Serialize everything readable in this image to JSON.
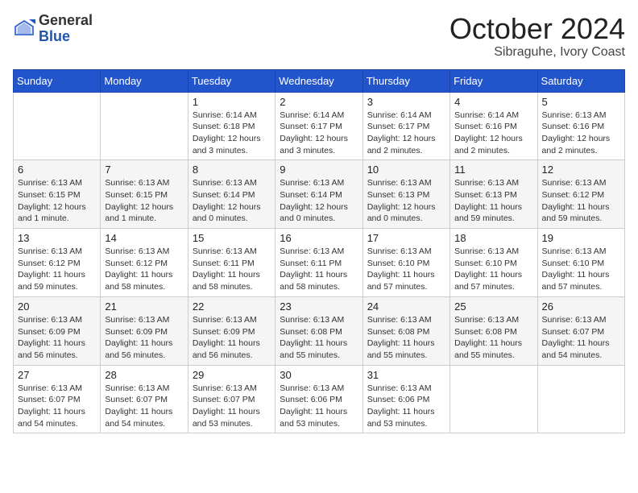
{
  "header": {
    "logo": {
      "general": "General",
      "blue": "Blue"
    },
    "month": "October 2024",
    "location": "Sibraguhe, Ivory Coast"
  },
  "weekdays": [
    "Sunday",
    "Monday",
    "Tuesday",
    "Wednesday",
    "Thursday",
    "Friday",
    "Saturday"
  ],
  "weeks": [
    [
      {
        "day": "",
        "sunrise": "",
        "sunset": "",
        "daylight": ""
      },
      {
        "day": "",
        "sunrise": "",
        "sunset": "",
        "daylight": ""
      },
      {
        "day": "1",
        "sunrise": "Sunrise: 6:14 AM",
        "sunset": "Sunset: 6:18 PM",
        "daylight": "Daylight: 12 hours and 3 minutes."
      },
      {
        "day": "2",
        "sunrise": "Sunrise: 6:14 AM",
        "sunset": "Sunset: 6:17 PM",
        "daylight": "Daylight: 12 hours and 3 minutes."
      },
      {
        "day": "3",
        "sunrise": "Sunrise: 6:14 AM",
        "sunset": "Sunset: 6:17 PM",
        "daylight": "Daylight: 12 hours and 2 minutes."
      },
      {
        "day": "4",
        "sunrise": "Sunrise: 6:14 AM",
        "sunset": "Sunset: 6:16 PM",
        "daylight": "Daylight: 12 hours and 2 minutes."
      },
      {
        "day": "5",
        "sunrise": "Sunrise: 6:13 AM",
        "sunset": "Sunset: 6:16 PM",
        "daylight": "Daylight: 12 hours and 2 minutes."
      }
    ],
    [
      {
        "day": "6",
        "sunrise": "Sunrise: 6:13 AM",
        "sunset": "Sunset: 6:15 PM",
        "daylight": "Daylight: 12 hours and 1 minute."
      },
      {
        "day": "7",
        "sunrise": "Sunrise: 6:13 AM",
        "sunset": "Sunset: 6:15 PM",
        "daylight": "Daylight: 12 hours and 1 minute."
      },
      {
        "day": "8",
        "sunrise": "Sunrise: 6:13 AM",
        "sunset": "Sunset: 6:14 PM",
        "daylight": "Daylight: 12 hours and 0 minutes."
      },
      {
        "day": "9",
        "sunrise": "Sunrise: 6:13 AM",
        "sunset": "Sunset: 6:14 PM",
        "daylight": "Daylight: 12 hours and 0 minutes."
      },
      {
        "day": "10",
        "sunrise": "Sunrise: 6:13 AM",
        "sunset": "Sunset: 6:13 PM",
        "daylight": "Daylight: 12 hours and 0 minutes."
      },
      {
        "day": "11",
        "sunrise": "Sunrise: 6:13 AM",
        "sunset": "Sunset: 6:13 PM",
        "daylight": "Daylight: 11 hours and 59 minutes."
      },
      {
        "day": "12",
        "sunrise": "Sunrise: 6:13 AM",
        "sunset": "Sunset: 6:12 PM",
        "daylight": "Daylight: 11 hours and 59 minutes."
      }
    ],
    [
      {
        "day": "13",
        "sunrise": "Sunrise: 6:13 AM",
        "sunset": "Sunset: 6:12 PM",
        "daylight": "Daylight: 11 hours and 59 minutes."
      },
      {
        "day": "14",
        "sunrise": "Sunrise: 6:13 AM",
        "sunset": "Sunset: 6:12 PM",
        "daylight": "Daylight: 11 hours and 58 minutes."
      },
      {
        "day": "15",
        "sunrise": "Sunrise: 6:13 AM",
        "sunset": "Sunset: 6:11 PM",
        "daylight": "Daylight: 11 hours and 58 minutes."
      },
      {
        "day": "16",
        "sunrise": "Sunrise: 6:13 AM",
        "sunset": "Sunset: 6:11 PM",
        "daylight": "Daylight: 11 hours and 58 minutes."
      },
      {
        "day": "17",
        "sunrise": "Sunrise: 6:13 AM",
        "sunset": "Sunset: 6:10 PM",
        "daylight": "Daylight: 11 hours and 57 minutes."
      },
      {
        "day": "18",
        "sunrise": "Sunrise: 6:13 AM",
        "sunset": "Sunset: 6:10 PM",
        "daylight": "Daylight: 11 hours and 57 minutes."
      },
      {
        "day": "19",
        "sunrise": "Sunrise: 6:13 AM",
        "sunset": "Sunset: 6:10 PM",
        "daylight": "Daylight: 11 hours and 57 minutes."
      }
    ],
    [
      {
        "day": "20",
        "sunrise": "Sunrise: 6:13 AM",
        "sunset": "Sunset: 6:09 PM",
        "daylight": "Daylight: 11 hours and 56 minutes."
      },
      {
        "day": "21",
        "sunrise": "Sunrise: 6:13 AM",
        "sunset": "Sunset: 6:09 PM",
        "daylight": "Daylight: 11 hours and 56 minutes."
      },
      {
        "day": "22",
        "sunrise": "Sunrise: 6:13 AM",
        "sunset": "Sunset: 6:09 PM",
        "daylight": "Daylight: 11 hours and 56 minutes."
      },
      {
        "day": "23",
        "sunrise": "Sunrise: 6:13 AM",
        "sunset": "Sunset: 6:08 PM",
        "daylight": "Daylight: 11 hours and 55 minutes."
      },
      {
        "day": "24",
        "sunrise": "Sunrise: 6:13 AM",
        "sunset": "Sunset: 6:08 PM",
        "daylight": "Daylight: 11 hours and 55 minutes."
      },
      {
        "day": "25",
        "sunrise": "Sunrise: 6:13 AM",
        "sunset": "Sunset: 6:08 PM",
        "daylight": "Daylight: 11 hours and 55 minutes."
      },
      {
        "day": "26",
        "sunrise": "Sunrise: 6:13 AM",
        "sunset": "Sunset: 6:07 PM",
        "daylight": "Daylight: 11 hours and 54 minutes."
      }
    ],
    [
      {
        "day": "27",
        "sunrise": "Sunrise: 6:13 AM",
        "sunset": "Sunset: 6:07 PM",
        "daylight": "Daylight: 11 hours and 54 minutes."
      },
      {
        "day": "28",
        "sunrise": "Sunrise: 6:13 AM",
        "sunset": "Sunset: 6:07 PM",
        "daylight": "Daylight: 11 hours and 54 minutes."
      },
      {
        "day": "29",
        "sunrise": "Sunrise: 6:13 AM",
        "sunset": "Sunset: 6:07 PM",
        "daylight": "Daylight: 11 hours and 53 minutes."
      },
      {
        "day": "30",
        "sunrise": "Sunrise: 6:13 AM",
        "sunset": "Sunset: 6:06 PM",
        "daylight": "Daylight: 11 hours and 53 minutes."
      },
      {
        "day": "31",
        "sunrise": "Sunrise: 6:13 AM",
        "sunset": "Sunset: 6:06 PM",
        "daylight": "Daylight: 11 hours and 53 minutes."
      },
      {
        "day": "",
        "sunrise": "",
        "sunset": "",
        "daylight": ""
      },
      {
        "day": "",
        "sunrise": "",
        "sunset": "",
        "daylight": ""
      }
    ]
  ]
}
